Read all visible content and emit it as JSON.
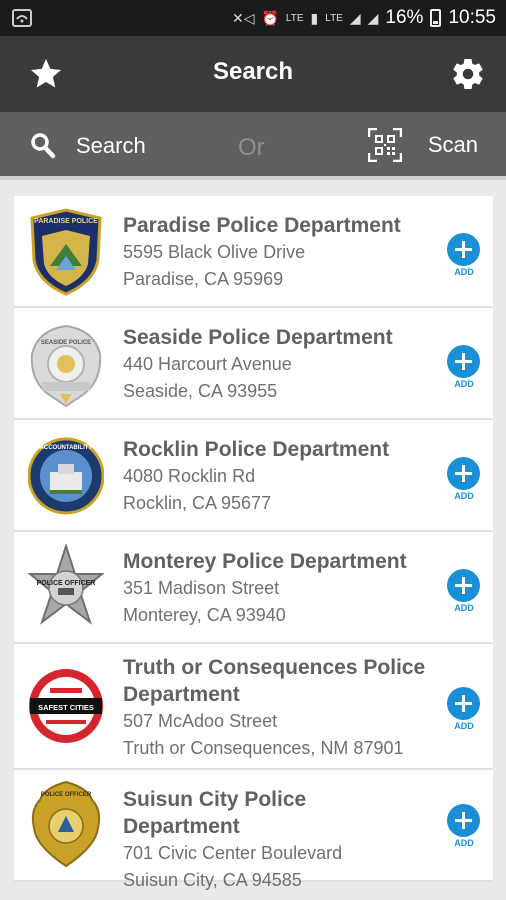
{
  "status_bar": {
    "battery": "16%",
    "time": "10:55",
    "net1": "LTE",
    "net2": "LTE"
  },
  "app_bar": {
    "title": "Search"
  },
  "search_bar": {
    "search_label": "Search",
    "or_label": "Or",
    "scan_label": "Scan"
  },
  "departments": [
    {
      "name": "Paradise Police Department",
      "address1": "5595 Black Olive Drive",
      "address2": "Paradise, CA 95969",
      "add_label": "ADD",
      "badge_text": "PARADISE POLICE"
    },
    {
      "name": "Seaside Police Department",
      "address1": "440 Harcourt Avenue",
      "address2": "Seaside, CA 93955",
      "add_label": "ADD",
      "badge_text": "SEASIDE POLICE"
    },
    {
      "name": "Rocklin Police Department",
      "address1": "4080 Rocklin Rd",
      "address2": "Rocklin, CA 95677",
      "add_label": "ADD",
      "badge_text": "ACCOUNTABILITY"
    },
    {
      "name": "Monterey Police Department",
      "address1": "351 Madison Street",
      "address2": "Monterey, CA 93940",
      "add_label": "ADD",
      "badge_text": "POLICE OFFICER"
    },
    {
      "name": "Truth or Consequences Police Department",
      "address1": "507 McAdoo Street",
      "address2": "Truth or Consequences, NM 87901",
      "add_label": "ADD",
      "badge_text": "SAFEST CITIES"
    },
    {
      "name": "Suisun City Police Department",
      "address1": "701 Civic Center Boulevard",
      "address2": "Suisun City, CA 94585",
      "add_label": "ADD",
      "badge_text": "POLICE OFFICER"
    }
  ],
  "colors": {
    "accent": "#1a8fd6",
    "app_bar": "#3a3a3a",
    "search_bar": "#5f5f5f"
  }
}
